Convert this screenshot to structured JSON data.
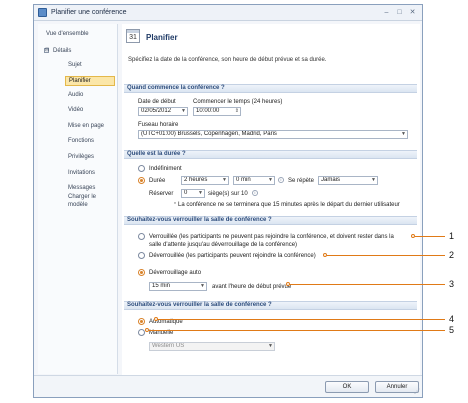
{
  "window": {
    "title": "Planifier une conférence"
  },
  "sidebar": {
    "top_item": "Vue d'ensemble",
    "group_label": "Détails",
    "group_toggle": "⊟",
    "items": [
      "Sujet",
      "Planifier",
      "Audio",
      "Vidéo",
      "Mise en page",
      "Fonctions",
      "Privilèges",
      "Invitations",
      "Messages",
      "Charger le modèle"
    ],
    "active_item": "Planifier"
  },
  "header": {
    "icon_text": "31",
    "title": "Planifier",
    "description": "Spécifiez la date de la conférence, son heure de début prévue et sa durée."
  },
  "when": {
    "section_title": "Quand commence la conférence ?",
    "start_date_label": "Date de début",
    "start_date_value": "02/05/2012",
    "start_time_label": "Commencer le temps (24 heures)",
    "start_time_value": "10:00:00",
    "timezone_label": "Fuseau horaire",
    "timezone_value": "(UTC+01:00) Brussels, Copenhagen, Madrid, Paris"
  },
  "duration": {
    "section_title": "Quelle est la durée ?",
    "indefinite_label": "Indéfiniment",
    "duration_label": "Durée",
    "hours_value": "2 heures",
    "minutes_value": "0 min",
    "repeat_label": "Se répète",
    "repeat_value": "Jamais",
    "reconnect_label": "Réserver",
    "reconnect_value": "0",
    "seats_text": "siège(s) sur 10",
    "note": "La conférence ne se terminera que 15 minutes après le départ du dernier utilisateur"
  },
  "lock": {
    "section_title": "Souhaitez-vous verrouiller la salle de conférence ?",
    "option_locked": "Verrouillée (les participants ne peuvent pas rejoindre la conférence, et doivent rester dans la",
    "option_locked_line2": "salle d'attente jusqu'au déverrouillage de la conférence)",
    "option_unlocked": "Déverrouillée (les participants peuvent rejoindre la conférence)",
    "option_auto": "Déverrouillage auto",
    "auto_value": "15 min",
    "auto_suffix": "avant l'heure de début prévue"
  },
  "lock2": {
    "section_title": "Souhaitez-vous verrouiller la salle de conférence ?",
    "option_automatic": "Automatique",
    "option_manual": "Manuelle",
    "region_value": "Western US"
  },
  "footer": {
    "ok_label": "OK",
    "cancel_label": "Annuler"
  },
  "callouts": [
    "1",
    "2",
    "3",
    "4",
    "5"
  ],
  "colors": {
    "accent": "#e07a17",
    "section_text": "#2c4c7c",
    "active_nav": "#fbe6a8"
  }
}
